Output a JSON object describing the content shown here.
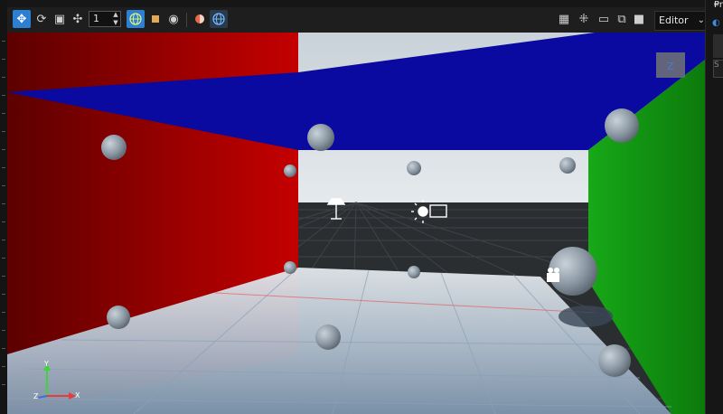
{
  "toolbar": {
    "snap_increment": "1",
    "icons": [
      "move-gizmo-icon",
      "rotate-icon",
      "scale-icon",
      "pivot-icon",
      "world-space-icon",
      "cube-icon",
      "visibility-icon",
      "render-mode-icon",
      "globe-icon",
      "grid-icon",
      "snap-icon",
      "display-icon",
      "screenshot-icon",
      "camera-icon"
    ],
    "view_mode": "Editor"
  },
  "right_panel": {
    "title": "Pro",
    "menu_glyph": "≡",
    "search_placeholder": "S"
  },
  "viewport": {
    "axis_x": "X",
    "axis_y": "Y",
    "axis_z": "Z",
    "orientation_label": "Z",
    "colors": {
      "left_wall": "#b40000",
      "right_wall": "#109810",
      "ceiling": "#0a0aa0",
      "floor": "#c9d3dc",
      "accent": "#2d7fd3"
    }
  }
}
